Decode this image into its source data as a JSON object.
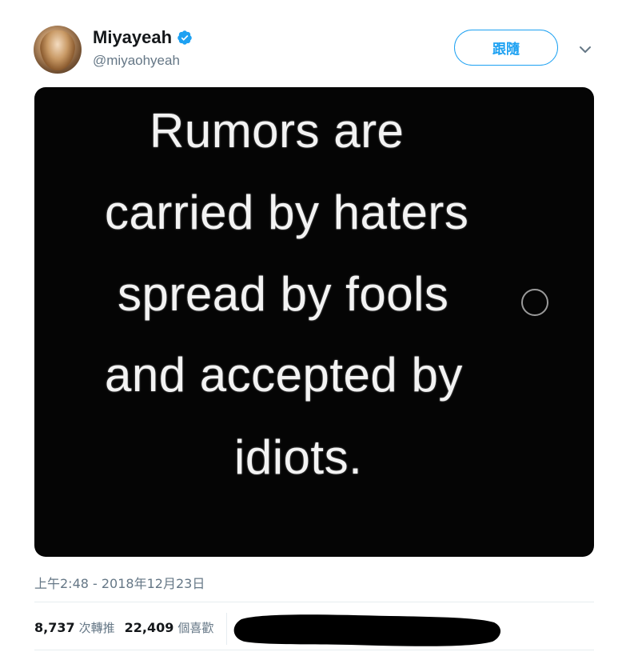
{
  "user": {
    "display_name": "Miyayeah",
    "handle": "@miyaohyeah",
    "verified": true
  },
  "follow_button": {
    "label": "跟隨"
  },
  "media": {
    "lines": [
      "Rumors are",
      "carried by haters",
      "spread by fools",
      "and accepted by",
      "idiots."
    ]
  },
  "timestamp": "上午2:48 - 2018年12月23日",
  "stats": {
    "retweets_count": "8,737",
    "retweets_label": "次轉推",
    "likes_count": "22,409",
    "likes_label": "個喜歡"
  },
  "colors": {
    "accent": "#1da1f2",
    "text_primary": "#14171a",
    "text_secondary": "#657786",
    "media_background": "#050505"
  },
  "icons": {
    "verified": "verified-badge-icon",
    "caret": "chevron-down-icon"
  }
}
